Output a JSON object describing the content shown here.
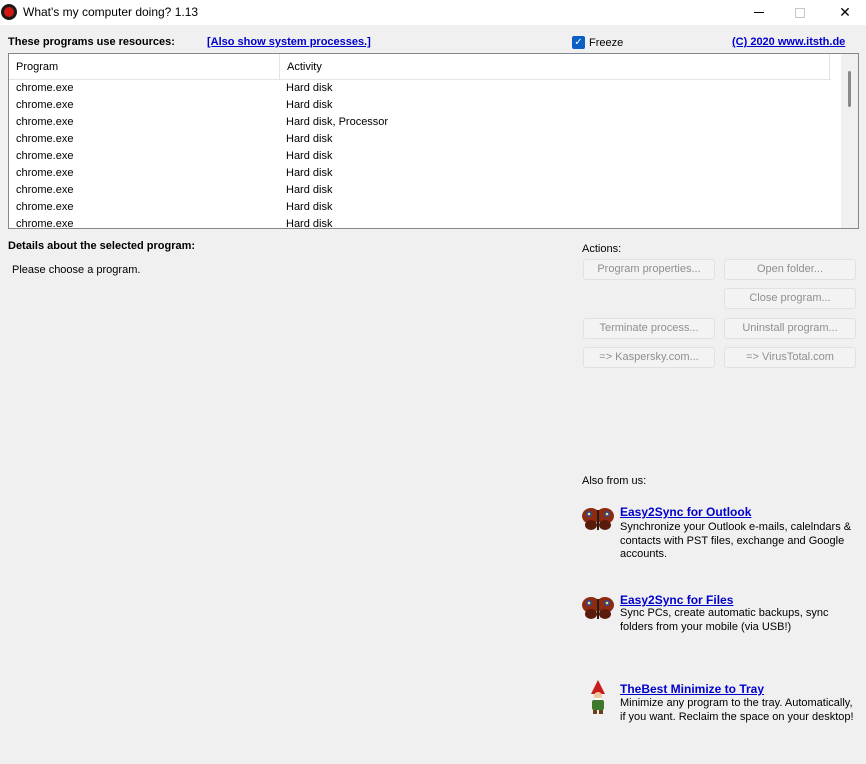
{
  "window": {
    "title": "What's my computer doing? 1.13",
    "minimize_icon": "minimize-icon",
    "maximize_icon": "maximize-icon",
    "close_icon": "close-icon",
    "close_glyph": "✕"
  },
  "top": {
    "heading": "These programs use resources:",
    "system_link": "[Also show system processes.]",
    "freeze_label": "Freeze",
    "freeze_checked": true,
    "copyright_link": "(C) 2020 www.itsth.de"
  },
  "list": {
    "columns": [
      "Program",
      "Activity"
    ],
    "rows": [
      {
        "program": "chrome.exe",
        "activity": "Hard disk"
      },
      {
        "program": "chrome.exe",
        "activity": "Hard disk"
      },
      {
        "program": "chrome.exe",
        "activity": "Hard disk, Processor"
      },
      {
        "program": "chrome.exe",
        "activity": "Hard disk"
      },
      {
        "program": "chrome.exe",
        "activity": "Hard disk"
      },
      {
        "program": "chrome.exe",
        "activity": "Hard disk"
      },
      {
        "program": "chrome.exe",
        "activity": "Hard disk"
      },
      {
        "program": "chrome.exe",
        "activity": "Hard disk"
      },
      {
        "program": "chrome.exe",
        "activity": "Hard disk"
      }
    ]
  },
  "details": {
    "heading": "Details about the selected program:",
    "placeholder": "Please choose a program."
  },
  "actions": {
    "label": "Actions:",
    "program_properties": "Program properties...",
    "open_folder": "Open folder...",
    "close_program": "Close program...",
    "terminate_process": "Terminate process...",
    "uninstall_program": "Uninstall program...",
    "kaspersky": "=> Kaspersky.com...",
    "virustotal": "=> VirusTotal.com"
  },
  "promo": {
    "label": "Also from us:",
    "items": [
      {
        "title": "Easy2Sync for Outlook",
        "desc": "Synchronize your Outlook e-mails, calelndars & contacts with PST files, exchange and Google accounts.",
        "icon": "butterfly-icon"
      },
      {
        "title": "Easy2Sync for Files",
        "desc": "Sync PCs, create automatic backups, sync folders from your mobile (via USB!)",
        "icon": "butterfly-icon"
      },
      {
        "title": "TheBest Minimize to Tray",
        "desc": "Minimize any program to the tray. Automatically, if you want. Reclaim the space on your desktop!",
        "icon": "gnome-icon"
      }
    ]
  }
}
